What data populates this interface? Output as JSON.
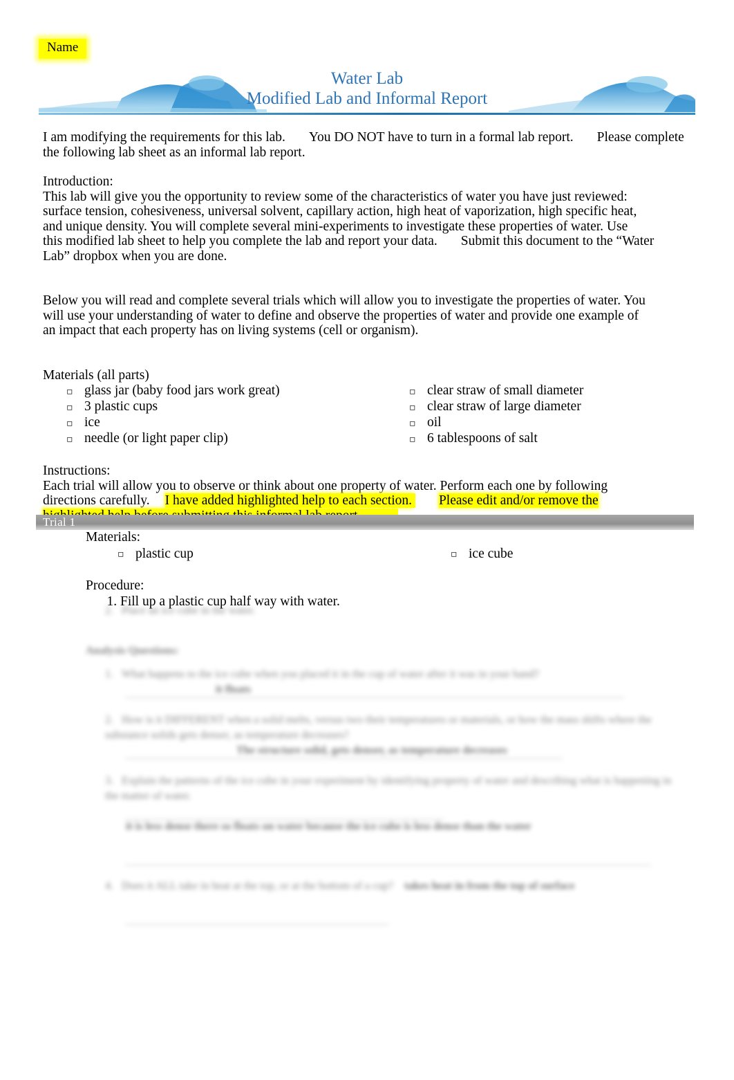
{
  "header": {
    "name_label": "Name",
    "title_line1": "Water Lab",
    "title_line2": "Modified Lab and Informal Report"
  },
  "intro": {
    "modify_p1": "I am modifying the requirements for this lab.",
    "modify_p2": "You DO NOT have to turn in a formal lab report.",
    "modify_p3": "Please complete the following lab sheet as an informal lab report.",
    "introduction_label": "Introduction:",
    "introduction_body_1": "This lab will give you the opportunity to review some of the characteristics of water you have just reviewed:",
    "introduction_body_2": "surface tension, cohesiveness, universal solvent, capillary action, high heat of vaporization, high specific heat,",
    "introduction_body_3": "and unique density. You will complete several mini-experiments to investigate these properties of water. Use",
    "introduction_body_4": "this modified lab sheet to help you complete the lab and report your data.",
    "introduction_body_5": "Submit this document to the “Water",
    "introduction_body_6": "Lab” dropbox when you are done.",
    "below_1": "Below you will read and complete several trials which will allow you to investigate the properties of water. You",
    "below_2": "will use your understanding of water to define and observe the properties of water and provide one example of",
    "below_3": "an impact that each property has on living systems (cell or organism)."
  },
  "materials": {
    "heading": "Materials (all parts)",
    "left": [
      "glass jar (baby food jars work great)",
      "3 plastic cups",
      "ice",
      "needle (or light paper clip)"
    ],
    "right": [
      "clear straw of small diameter",
      "clear straw of large diameter",
      "oil",
      "6 tablespoons of salt"
    ]
  },
  "instructions": {
    "heading": "Instructions:",
    "line1": "Each trial will allow you to observe or think about one property of water. Perform each one by following",
    "line2_plain": "directions carefully.",
    "line2_hl": "I have added highlighted help to each section.",
    "line2_hl2": "Please edit and/or remove the",
    "line3_hl": "highlighted help before submitting this informal lab report",
    "line3_end": "."
  },
  "trial1": {
    "banner": "Trial 1",
    "materials_label": "Materials:",
    "material_left": "plastic cup",
    "material_right": "ice cube",
    "procedure_label": "Procedure:",
    "procedure_steps": [
      "Fill up a plastic cup half way with water.",
      "Place an ice cube in the water."
    ],
    "questions_label": "Analysis Questions:",
    "questions": [
      "What happens to the ice cube when you placed it in the cup of water after it was in your hand?",
      "How is it DIFFERENT when a solid melts, versus two their temperatures or materials, or how the mass shifts where the substance solids gets denser, as temperature decreases?",
      "Explain the patterns of the ice cube in your experiment by identifying property of water and describing what is happening in the matter of water.",
      "Does it ALL take in heat at the top, or at the bottom of a cup?"
    ],
    "answers": [
      "it floats",
      "The structure solid, gets denser, as temperature decreases",
      "it is less dense there so floats on water because the ice cube is less dense than the water",
      "takes heat in from the top of surface"
    ]
  },
  "colors": {
    "title_blue": "#2e74b5",
    "highlight_yellow": "#ffff00",
    "banner_gray": "#8f8f8f"
  }
}
